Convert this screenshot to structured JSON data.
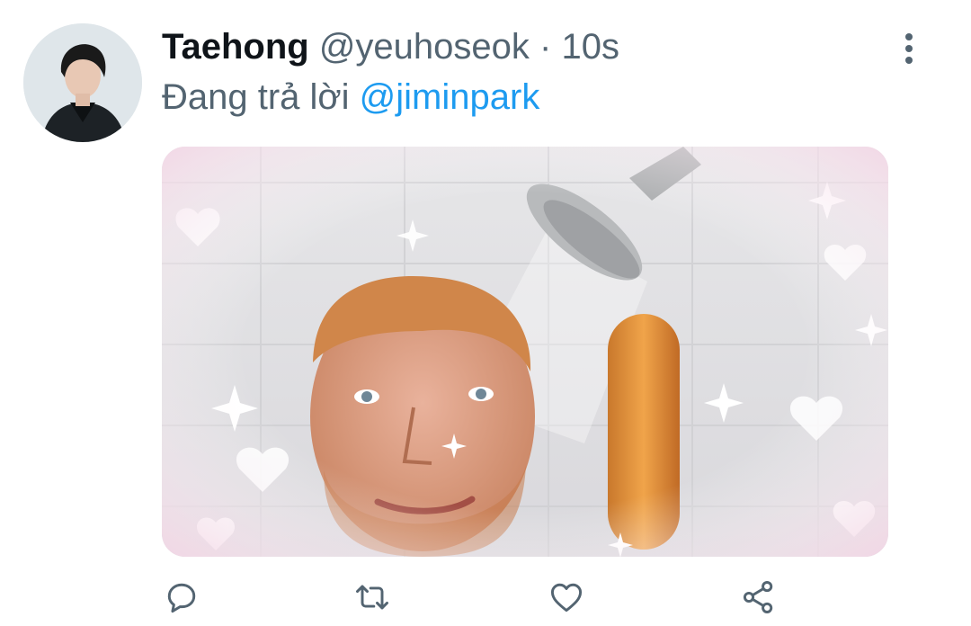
{
  "tweet": {
    "display_name": "Taehong",
    "handle": "@yeuhoseok",
    "separator": "·",
    "time": "10s",
    "reply_prefix": "Đang trả lời",
    "reply_mention": "@jiminpark"
  },
  "icons": {
    "more": "more-vertical-icon",
    "reply": "reply-icon",
    "retweet": "retweet-icon",
    "like": "heart-icon",
    "share": "share-icon"
  },
  "colors": {
    "text_primary": "#0f1419",
    "text_secondary": "#536471",
    "link": "#1d9bf0"
  }
}
